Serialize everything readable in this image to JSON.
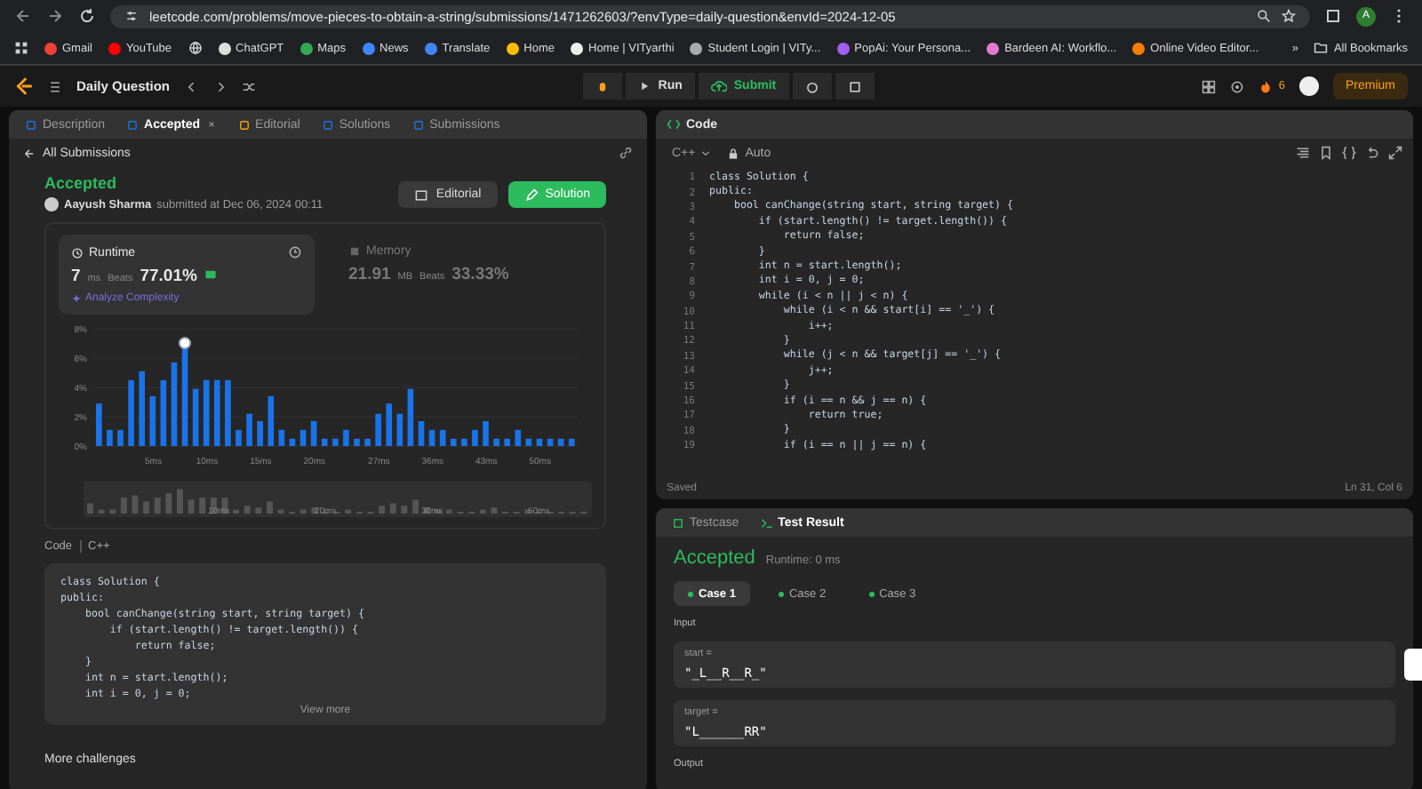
{
  "browser": {
    "url": "leetcode.com/problems/move-pieces-to-obtain-a-string/submissions/1471262603/?envType=daily-question&envId=2024-12-05",
    "bookmarks": [
      {
        "kind": "link",
        "label": "Gmail"
      },
      {
        "kind": "link",
        "label": "YouTube"
      },
      {
        "kind": "icon"
      },
      {
        "kind": "link",
        "label": "ChatGPT"
      },
      {
        "kind": "link",
        "label": "Maps"
      },
      {
        "kind": "link",
        "label": "News"
      },
      {
        "kind": "link",
        "label": "Translate"
      },
      {
        "kind": "link",
        "label": "Home"
      },
      {
        "kind": "link",
        "label": "Home | VITyarthi"
      },
      {
        "kind": "link",
        "label": "Student Login | VITy..."
      },
      {
        "kind": "link",
        "label": "PopAi: Your Persona..."
      },
      {
        "kind": "link",
        "label": "Bardeen AI: Workflo..."
      },
      {
        "kind": "link",
        "label": "Online Video Editor..."
      }
    ],
    "more": "»",
    "all_bookmarks": "All Bookmarks",
    "profile_initial": "A"
  },
  "nav": {
    "title": "Daily Question",
    "run": "Run",
    "submit": "Submit",
    "streak": "6",
    "premium": "Premium"
  },
  "left": {
    "tabs": [
      {
        "label": "Description",
        "selected": false
      },
      {
        "label": "Accepted",
        "selected": true
      },
      {
        "label": "Editorial",
        "selected": false
      },
      {
        "label": "Solutions",
        "selected": false
      },
      {
        "label": "Submissions",
        "selected": false
      }
    ],
    "back": "All Submissions",
    "status": "Accepted",
    "user": "Aayush Sharma",
    "submitted": "submitted at Dec 06, 2024 00:11",
    "editorial_button": "Editorial",
    "solution_button": "Solution",
    "runtime": {
      "label": "Runtime",
      "value": "7",
      "unit": "ms",
      "beats_label": "Beats",
      "beats": "77.01%",
      "analyze": "Analyze Complexity"
    },
    "memory": {
      "label": "Memory",
      "value": "21.91",
      "unit": "MB",
      "beats_label": "Beats",
      "beats": "33.33%"
    },
    "chart_data": {
      "type": "bar",
      "grid": true,
      "ylim": [
        0,
        8
      ],
      "yticks": [
        {
          "value": 0,
          "label": "0%"
        },
        {
          "value": 2,
          "label": "2%"
        },
        {
          "value": 4,
          "label": "4%"
        },
        {
          "value": 6,
          "label": "6%"
        },
        {
          "value": 8,
          "label": "8%"
        }
      ],
      "categories": [
        null,
        null,
        null,
        null,
        null,
        "5ms",
        null,
        null,
        null,
        null,
        "10ms",
        null,
        null,
        null,
        null,
        "15ms",
        null,
        null,
        null,
        null,
        "20ms",
        null,
        null,
        null,
        null,
        null,
        "27ms",
        null,
        null,
        null,
        null,
        "36ms",
        null,
        null,
        null,
        null,
        "43ms",
        null,
        null,
        null,
        null,
        "50ms",
        null,
        null,
        null
      ],
      "series": [
        {
          "color": "#1a73e8",
          "values": [
            2.9,
            1.1,
            1.1,
            4.5,
            5.1,
            3.4,
            4.5,
            5.7,
            6.9,
            3.9,
            4.5,
            4.5,
            4.5,
            1.1,
            2.2,
            1.7,
            3.4,
            1.1,
            0.5,
            1.1,
            1.7,
            0.5,
            0.5,
            1.1,
            0.5,
            0.5,
            2.2,
            2.9,
            2.2,
            3.9,
            1.7,
            1.1,
            1.1,
            0.5,
            0.5,
            1.1,
            1.7,
            0.5,
            0.5,
            1.1,
            0.5,
            0.5,
            0.5,
            0.5,
            0.5
          ]
        }
      ]
    },
    "brush_labels": [
      "10ms",
      "20ms",
      "30ms",
      "50ms"
    ],
    "code_label": "Code",
    "language": "C++",
    "code_preview": [
      "class Solution {",
      "public:",
      "    bool canChange(string start, string target) {",
      "        if (start.length() != target.length()) {",
      "            return false;",
      "    }",
      "    int n = start.length();",
      "    int i = 0, j = 0;"
    ],
    "view_more": "View more",
    "more_challenges": "More challenges"
  },
  "editor": {
    "title": "Code",
    "language": "C++",
    "mode": "Auto",
    "lines": [
      {
        "number": "1",
        "text": "class Solution {"
      },
      {
        "number": "2",
        "text": "public:"
      },
      {
        "number": "3",
        "text": "    bool canChange(string start, string target) {"
      },
      {
        "number": "4",
        "text": "        if (start.length() != target.length()) {"
      },
      {
        "number": "5",
        "text": "            return false;"
      },
      {
        "number": "6",
        "text": "        }"
      },
      {
        "number": "7",
        "text": "        int n = start.length();"
      },
      {
        "number": "8",
        "text": "        int i = 0, j = 0;"
      },
      {
        "number": "9",
        "text": "        while (i < n || j < n) {"
      },
      {
        "number": "10",
        "text": "            while (i < n && start[i] == '_') {"
      },
      {
        "number": "11",
        "text": "                i++;"
      },
      {
        "number": "12",
        "text": "            }"
      },
      {
        "number": "13",
        "text": "            while (j < n && target[j] == '_') {"
      },
      {
        "number": "14",
        "text": "                j++;"
      },
      {
        "number": "15",
        "text": "            }"
      },
      {
        "number": "16",
        "text": "            if (i == n && j == n) {"
      },
      {
        "number": "17",
        "text": "                return true;"
      },
      {
        "number": "18",
        "text": "            }"
      },
      {
        "number": "19",
        "text": "            if (i == n || j == n) {"
      }
    ],
    "status": "Saved",
    "cursor": "Ln 31, Col 6"
  },
  "result": {
    "tabs": [
      {
        "label": "Testcase",
        "selected": false
      },
      {
        "label": "Test Result",
        "selected": true
      }
    ],
    "verdict": "Accepted",
    "runtime": "Runtime: 0 ms",
    "cases": [
      {
        "label": "Case 1",
        "selected": true
      },
      {
        "label": "Case 2",
        "selected": false
      },
      {
        "label": "Case 3",
        "selected": false
      }
    ],
    "input_label": "Input",
    "inputs": [
      {
        "name": "start =",
        "value": "\"_L__R__R_\""
      },
      {
        "name": "target =",
        "value": "\"L______RR\""
      }
    ],
    "output_label": "Output"
  }
}
